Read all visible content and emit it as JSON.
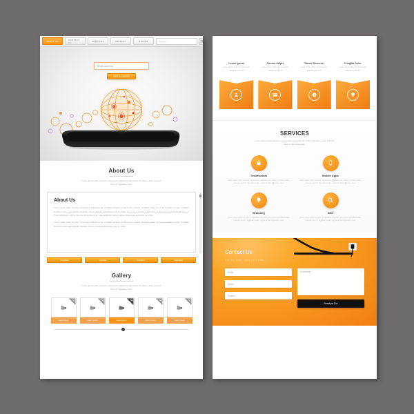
{
  "canvas": {
    "background": "#6e6c6c",
    "accent": "#f7941e"
  },
  "left_page": {
    "nav": {
      "items": [
        {
          "label": "ABOUT US",
          "active": true
        },
        {
          "label": "CONTACT US",
          "active": false
        },
        {
          "label": "SERVICES",
          "active": false
        },
        {
          "label": "GALLERY",
          "active": false
        },
        {
          "label": "FORUM",
          "active": false
        }
      ],
      "search_placeholder": "Search...",
      "search_icon": "search-icon"
    },
    "hero": {
      "email_placeholder": "Email Address",
      "cta_label": "GET ACCESS",
      "illustration": "globe-over-smartphone"
    },
    "about_section": {
      "title": "About Us",
      "subtitle": "Lorem ipsum dolor sit amet, consectetur adipiscing elit. Fusce vel dolor mattis, pulvinar risus id, dignissim justo.",
      "panel_title": "About Us",
      "paragraph_1": "Lorem ipsum dolor sit amet, consectetur adipiscing elit. Curabitur aliquam condimentum suscipit. Curabitur vitae orci et leo hendrerit cursus. Curabitur tincidunt metus eget gravida vulputate. Donec gravida pellentesque nisi ac mollis. Donec eget gravida mauris. Duis malesuada augue ut fringilla ultrices. Proin sollicitudin, nibh in rhoncus fermentum eros, nulla vestibulum lacus, varius consectetur est lectus nec eros.",
      "paragraph_2": "Lorem ipsum dolor sit amet, consectetur adipiscing elit. Curabitur aliquam condimentum suscipit. Curabitur vitae orci et leo hendrerit cursus. Curabitur tincidunt metus eget gravida vulputate. Donec gravida pellentesque nisi ac mollis.",
      "buttons": [
        {
          "label": "Curabitur"
        },
        {
          "label": "Gravida"
        },
        {
          "label": "Tincidunt"
        },
        {
          "label": "Vulputate"
        }
      ]
    },
    "gallery_section": {
      "title": "Gallery",
      "subtitle": "Lorem ipsum dolor sit amet, consectetur adipiscing elit. Fusce vel dolor mattis, pulvinar risus id, dignissim justo.",
      "items": [
        {
          "caption": "Lorem Ipsum",
          "active": false,
          "icon": "camera-icon",
          "zoom_icon": "zoom-icon"
        },
        {
          "caption": "Lorem Ipsum",
          "active": false,
          "icon": "camera-icon",
          "zoom_icon": "zoom-icon"
        },
        {
          "caption": "Lorem Ipsum",
          "active": true,
          "icon": "camera-icon",
          "zoom_icon": "zoom-icon"
        },
        {
          "caption": "Lorem Ipsum",
          "active": false,
          "icon": "camera-icon",
          "zoom_icon": "zoom-icon"
        },
        {
          "caption": "Lorem Ipsum",
          "active": false,
          "icon": "camera-icon",
          "zoom_icon": "zoom-icon"
        }
      ]
    }
  },
  "right_page": {
    "features": [
      {
        "title": "Lorem Ipsum",
        "text": "Lorem ipsum dolor sit consectetur adipiscing elit sed",
        "icon": "users-icon"
      },
      {
        "title": "Consec Adipis",
        "text": "Lorem ipsum dolor sit consectetur adipiscing elit sed",
        "icon": "card-icon"
      },
      {
        "title": "Donec Rhoncus",
        "text": "Lorem ipsum dolor sit consectetur adipiscing elit sed",
        "icon": "coin-icon"
      },
      {
        "title": "Fringilla Dolor",
        "text": "Lorem ipsum dolor sit consectetur adipiscing elit sed",
        "icon": "bulb-icon"
      }
    ],
    "services_section": {
      "title": "SERVICES",
      "subtitle": "Lorem ipsum dolor sit amet, consectetur adipiscing elit. Fusce vel dolor mattis, pulvinar risus id, dignissim justo.",
      "items": [
        {
          "title": "Testimonials",
          "icon": "lock-icon",
          "text": "Lorem ipsum dolor sit amet, consectetur adipiscing elit. Fusce vel dolor mattis, pulvinar risus id, dignissim justo, magna at eros dignissim risus."
        },
        {
          "title": "Mobile Apps",
          "icon": "phone-icon",
          "text": "Lorem ipsum dolor sit amet, consectetur adipiscing elit. Fusce vel dolor mattis, pulvinar risus id, dignissim justo, magna at eros dignissim risus."
        },
        {
          "title": "Branding",
          "icon": "bulb-icon",
          "text": "Lorem ipsum dolor sit amet, consectetur adipiscing elit. Fusce vel dolor mattis, pulvinar risus id, dignissim justo, magna at eros dignissim risus."
        },
        {
          "title": "SEO",
          "icon": "search-icon",
          "text": "Lorem ipsum dolor sit amet, consectetur adipiscing elit. Fusce vel dolor mattis, pulvinar risus id, dignissim justo, magna at eros dignissim risus."
        }
      ]
    },
    "contact_section": {
      "title": "Contact Us",
      "subtitle": "GOT AN IDEA? DROP US A LINE!",
      "fields": [
        {
          "placeholder": "Email",
          "required_mark": "*"
        },
        {
          "placeholder": "Name",
          "required_mark": "*"
        },
        {
          "placeholder": "Subject",
          "required_mark": "*"
        }
      ],
      "comments_placeholder": "Comments",
      "comments_required_mark": "*",
      "submit_label": "Ready to Go!",
      "decor": [
        "desk-lamp",
        "wall-socket"
      ]
    }
  }
}
